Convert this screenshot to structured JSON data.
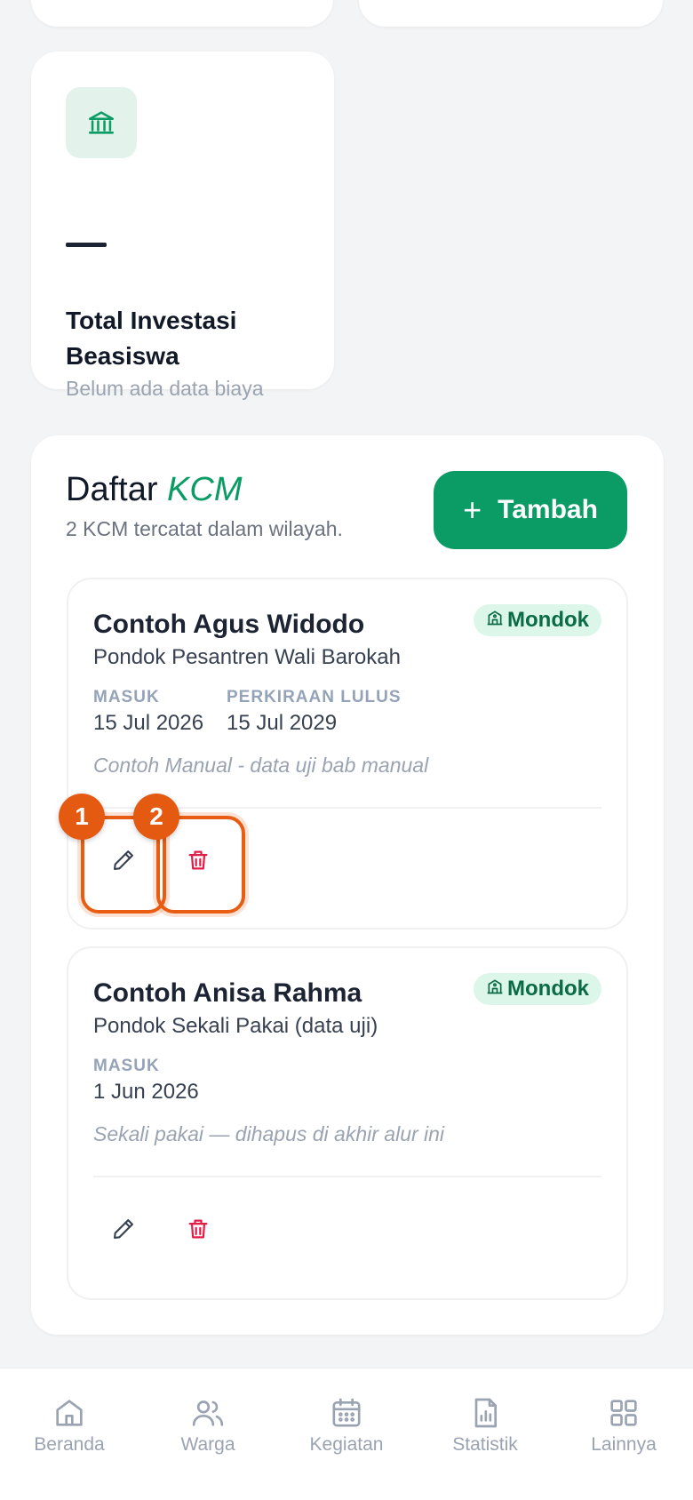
{
  "stat_card": {
    "value": "—",
    "label": "Total Investasi Beasiswa",
    "sub": "Belum ada data biaya",
    "icon": "bank-icon"
  },
  "list": {
    "title_prefix": "Daftar",
    "title_emphasis": "KCM",
    "subtitle": "2 KCM tercatat dalam wilayah.",
    "add_button_label": "Tambah",
    "items": [
      {
        "name": "Contoh Agus Widodo",
        "school": "Pondok Pesantren Wali Barokah",
        "badge": "Mondok",
        "masuk_label": "MASUK",
        "masuk_value": "15 Jul 2026",
        "lulus_label": "PERKIRAAN LULUS",
        "lulus_value": "15 Jul 2029",
        "note": "Contoh Manual - data uji bab manual"
      },
      {
        "name": "Contoh Anisa Rahma",
        "school": "Pondok Sekali Pakai (data uji)",
        "badge": "Mondok",
        "masuk_label": "MASUK",
        "masuk_value": "1 Jun 2026",
        "note": "Sekali pakai — dihapus di akhir alur ini"
      }
    ]
  },
  "highlights": [
    "1",
    "2"
  ],
  "nav": {
    "items": [
      {
        "label": "Beranda",
        "icon": "home-icon"
      },
      {
        "label": "Warga",
        "icon": "users-icon"
      },
      {
        "label": "Kegiatan",
        "icon": "calendar-icon"
      },
      {
        "label": "Statistik",
        "icon": "chart-file-icon"
      },
      {
        "label": "Lainnya",
        "icon": "grid-icon"
      }
    ]
  },
  "colors": {
    "accent": "#0b9b64",
    "danger": "#e11d48",
    "highlight": "#e55a11",
    "badge_bg": "#dcf7ea"
  }
}
